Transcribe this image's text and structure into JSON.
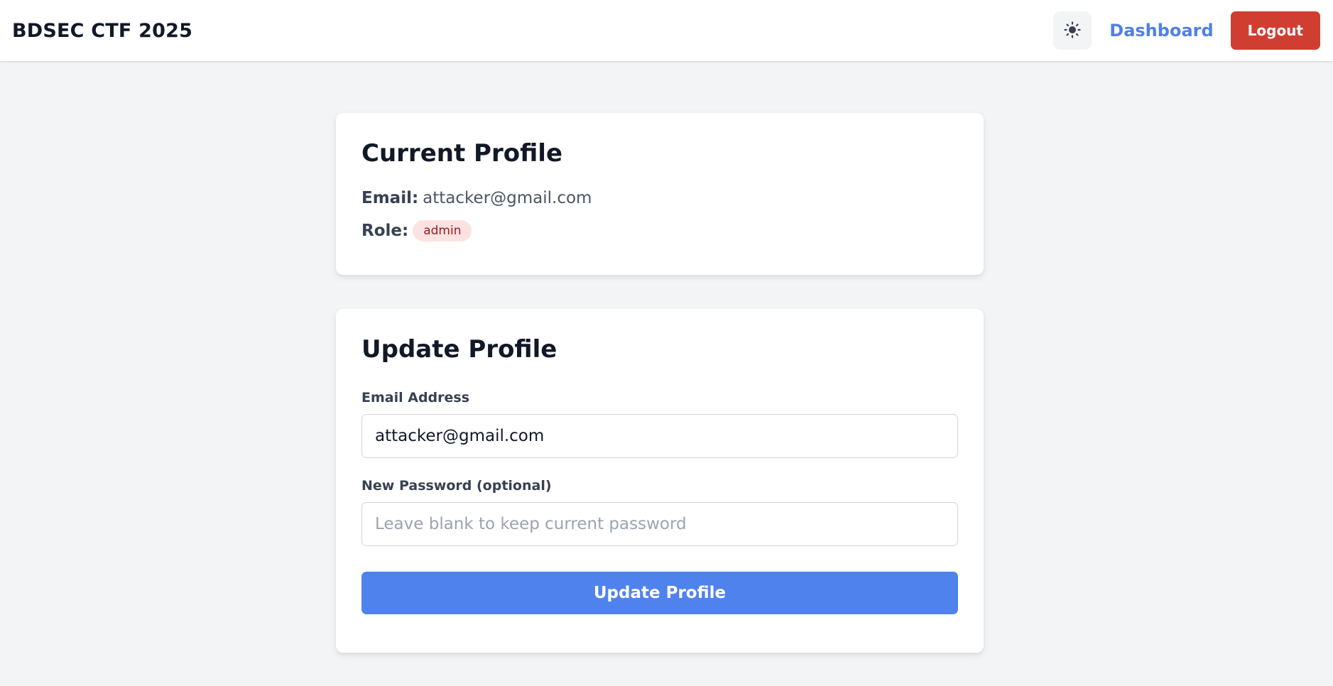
{
  "navbar": {
    "brand": "BDSEC CTF 2025",
    "theme_toggle_icon": "sun-icon",
    "dashboard_label": "Dashboard",
    "logout_label": "Logout"
  },
  "current_profile": {
    "title": "Current Profile",
    "email_label": "Email:",
    "email_value": "attacker@gmail.com",
    "role_label": "Role:",
    "role_value": "admin"
  },
  "update_profile": {
    "title": "Update Profile",
    "email_field_label": "Email Address",
    "email_value": "attacker@gmail.com",
    "password_field_label": "New Password (optional)",
    "password_placeholder": "Leave blank to keep current password",
    "password_value": "",
    "submit_label": "Update Profile"
  },
  "colors": {
    "page_background": "#f3f4f6",
    "link_blue": "#4f80e9",
    "logout_red": "#d03e32",
    "submit_blue": "#4f82ed",
    "role_badge_bg": "#fde2e2",
    "role_badge_text": "#991b1b"
  }
}
